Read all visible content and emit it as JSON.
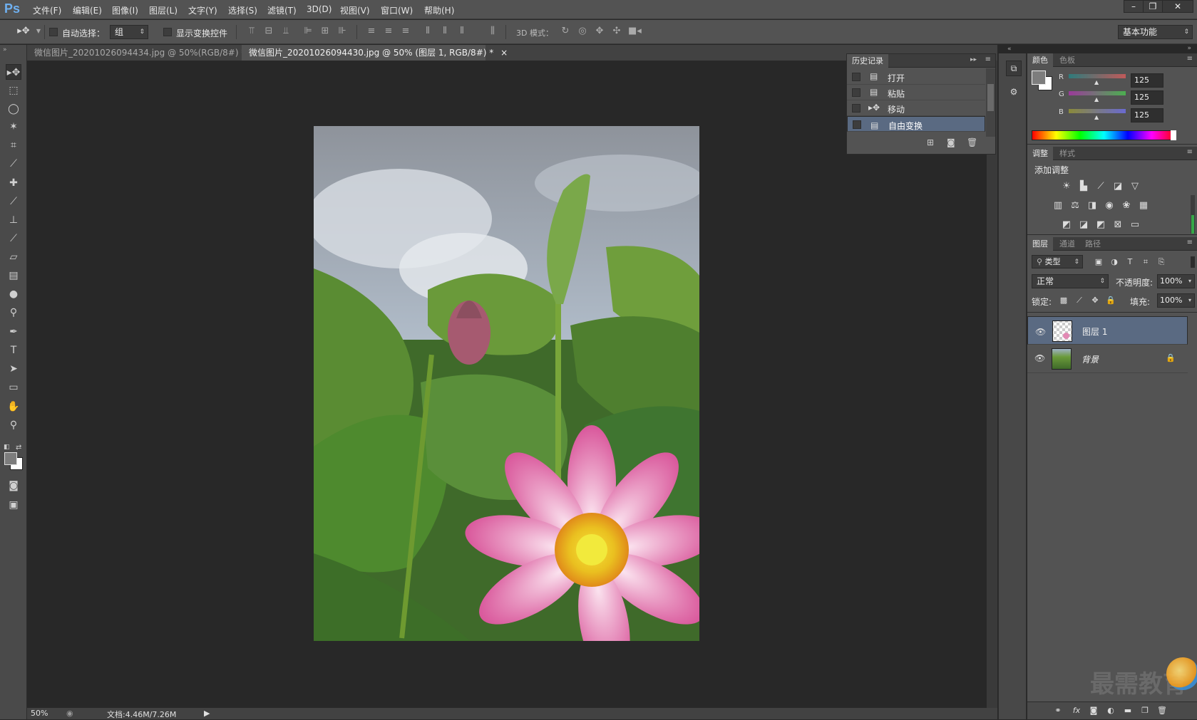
{
  "app": {
    "logo": "Ps"
  },
  "menubar": {
    "items": [
      "文件(F)",
      "编辑(E)",
      "图像(I)",
      "图层(L)",
      "文字(Y)",
      "选择(S)",
      "滤镜(T)",
      "3D(D)",
      "视图(V)",
      "窗口(W)",
      "帮助(H)"
    ],
    "window_buttons": [
      "–",
      "❐",
      "✕"
    ]
  },
  "options": {
    "auto_select_label": "自动选择：",
    "auto_select_value": "组",
    "show_transform_label": "显示变换控件",
    "mode3d_label": "3D 模式：",
    "workspace": "基本功能"
  },
  "tabs": [
    {
      "label": "微信图片_20201026094434.jpg @ 50%(RGB/8#) *",
      "close": "×",
      "active": false
    },
    {
      "label": "微信图片_20201026094430.jpg @ 50% (图层 1, RGB/8#) *",
      "close": "×",
      "active": true
    }
  ],
  "status": {
    "zoom": "50%",
    "doc": "文档:4.46M/7.26M"
  },
  "history": {
    "title": "历史记录",
    "items": [
      {
        "label": "打开",
        "icon": "doc-icon"
      },
      {
        "label": "粘贴",
        "icon": "doc-icon"
      },
      {
        "label": "移动",
        "icon": "move-icon"
      },
      {
        "label": "自由变换",
        "icon": "doc-icon",
        "selected": true
      }
    ]
  },
  "color_panel": {
    "tabs": [
      "颜色",
      "色板"
    ],
    "channels": [
      {
        "name": "R",
        "value": "125",
        "track_color": "#c05a5a"
      },
      {
        "name": "G",
        "value": "125",
        "track_color": "#4caf50"
      },
      {
        "name": "B",
        "value": "125",
        "track_color": "#6a6ad0"
      }
    ]
  },
  "adjust_panel": {
    "tabs": [
      "调整",
      "样式"
    ],
    "title": "添加调整"
  },
  "layers_panel": {
    "tabs": [
      "图层",
      "通道",
      "路径"
    ],
    "filter": "类型",
    "blend_mode": "正常",
    "opacity_label": "不透明度:",
    "opacity": "100%",
    "lock_label": "锁定:",
    "fill_label": "填充:",
    "fill": "100%",
    "layers": [
      {
        "name": "图层 1",
        "selected": true
      },
      {
        "name": "背景",
        "locked": true
      }
    ]
  },
  "watermark": {
    "text": "最需教育"
  }
}
